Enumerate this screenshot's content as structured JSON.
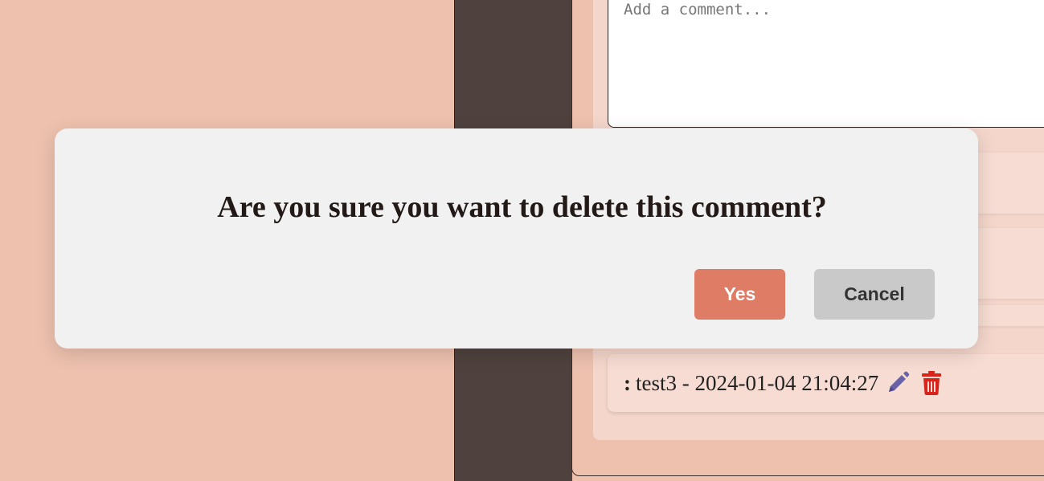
{
  "comment_form": {
    "placeholder": "Add a comment..."
  },
  "comments": [
    {
      "prefix": ":",
      "text": "test3 - 2024-01-04 21:04:27"
    }
  ],
  "modal": {
    "title": "Are you sure you want to delete this comment?",
    "yes_label": "Yes",
    "cancel_label": "Cancel"
  },
  "colors": {
    "background": "#edc1ae",
    "dark_column": "#4f423e",
    "card": "#f4d6cb",
    "modal": "#f1f1f1",
    "yes_button": "#de7c66",
    "cancel_button": "#c9c9c9",
    "edit_icon": "#6a62a8",
    "delete_icon": "#d9231a"
  },
  "icons": {
    "edit": "pencil-icon",
    "delete": "trash-icon"
  }
}
